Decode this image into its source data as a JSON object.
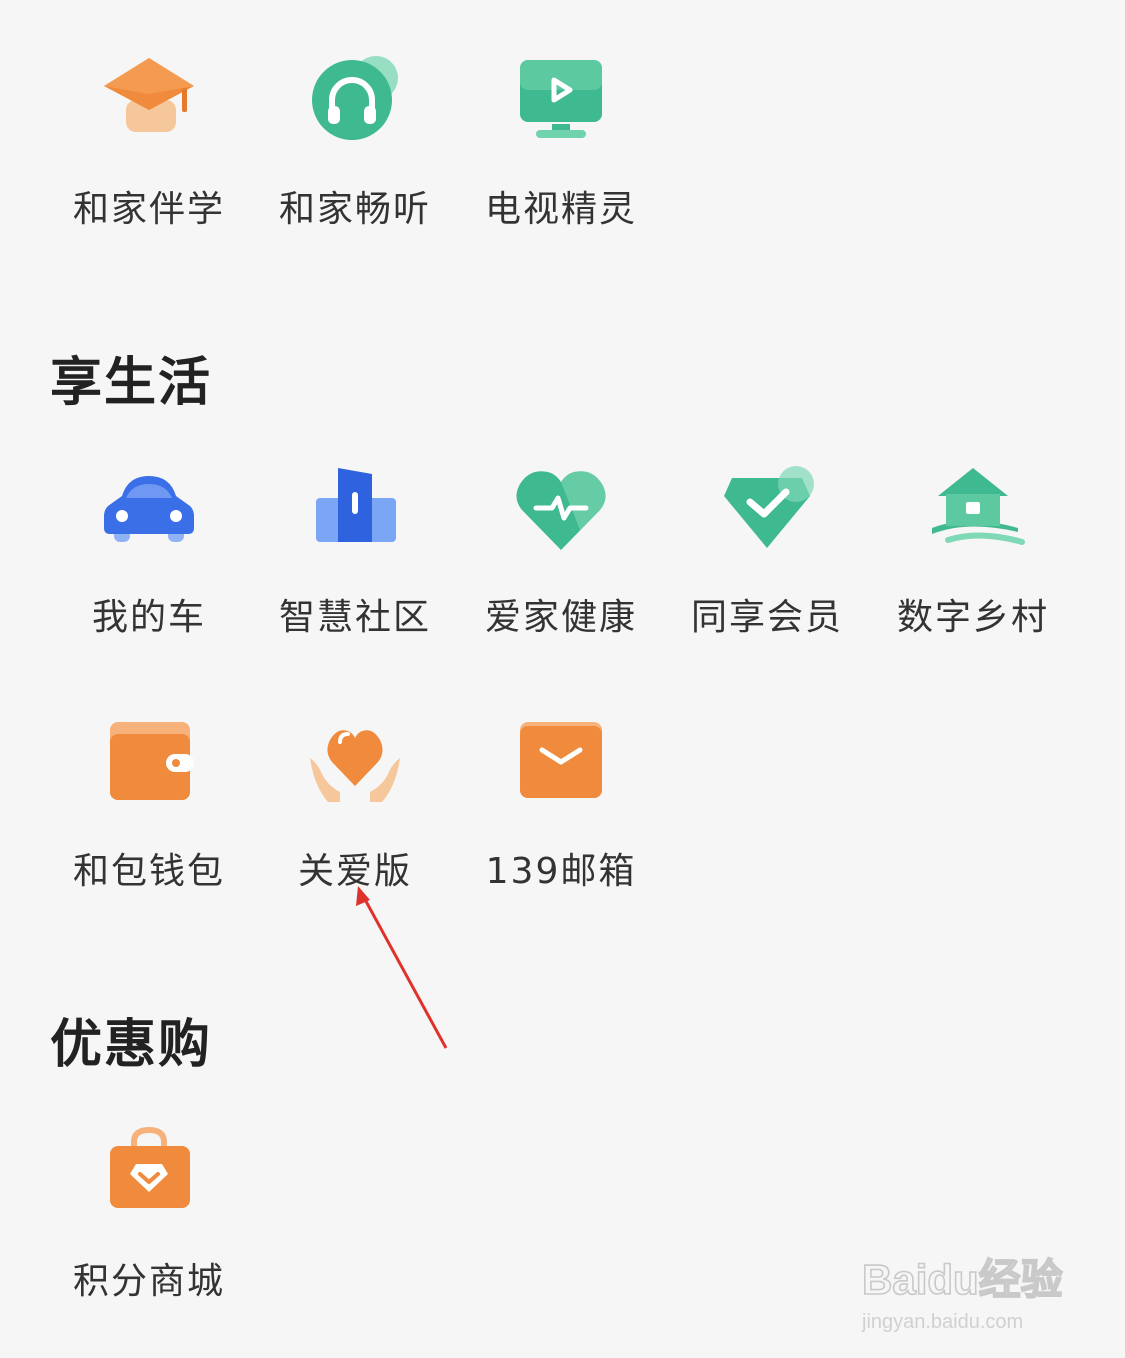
{
  "top_row": {
    "items": [
      {
        "label": "和家伴学",
        "icon": "graduation-cap-icon"
      },
      {
        "label": "和家畅听",
        "icon": "headphones-icon"
      },
      {
        "label": "电视精灵",
        "icon": "tv-play-icon"
      }
    ]
  },
  "life": {
    "title": "享生活",
    "items": [
      {
        "label": "我的车",
        "icon": "car-icon"
      },
      {
        "label": "智慧社区",
        "icon": "community-building-icon"
      },
      {
        "label": "爱家健康",
        "icon": "health-heart-icon"
      },
      {
        "label": "同享会员",
        "icon": "member-check-icon"
      },
      {
        "label": "数字乡村",
        "icon": "village-house-icon"
      },
      {
        "label": "和包钱包",
        "icon": "wallet-icon"
      },
      {
        "label": "关爱版",
        "icon": "care-hands-heart-icon"
      },
      {
        "label": "139邮箱",
        "icon": "mail-icon"
      }
    ]
  },
  "deals": {
    "title": "优惠购",
    "items": [
      {
        "label": "积分商城",
        "icon": "shopping-bag-icon"
      }
    ]
  },
  "watermark": {
    "brand": "Baidu经验",
    "url": "jingyan.baidu.com"
  },
  "colors": {
    "background": "#f6f6f6",
    "orange": "#f08a3c",
    "green": "#3fb98f",
    "blue": "#3a6fe8",
    "annotation_arrow": "#e0322d"
  }
}
